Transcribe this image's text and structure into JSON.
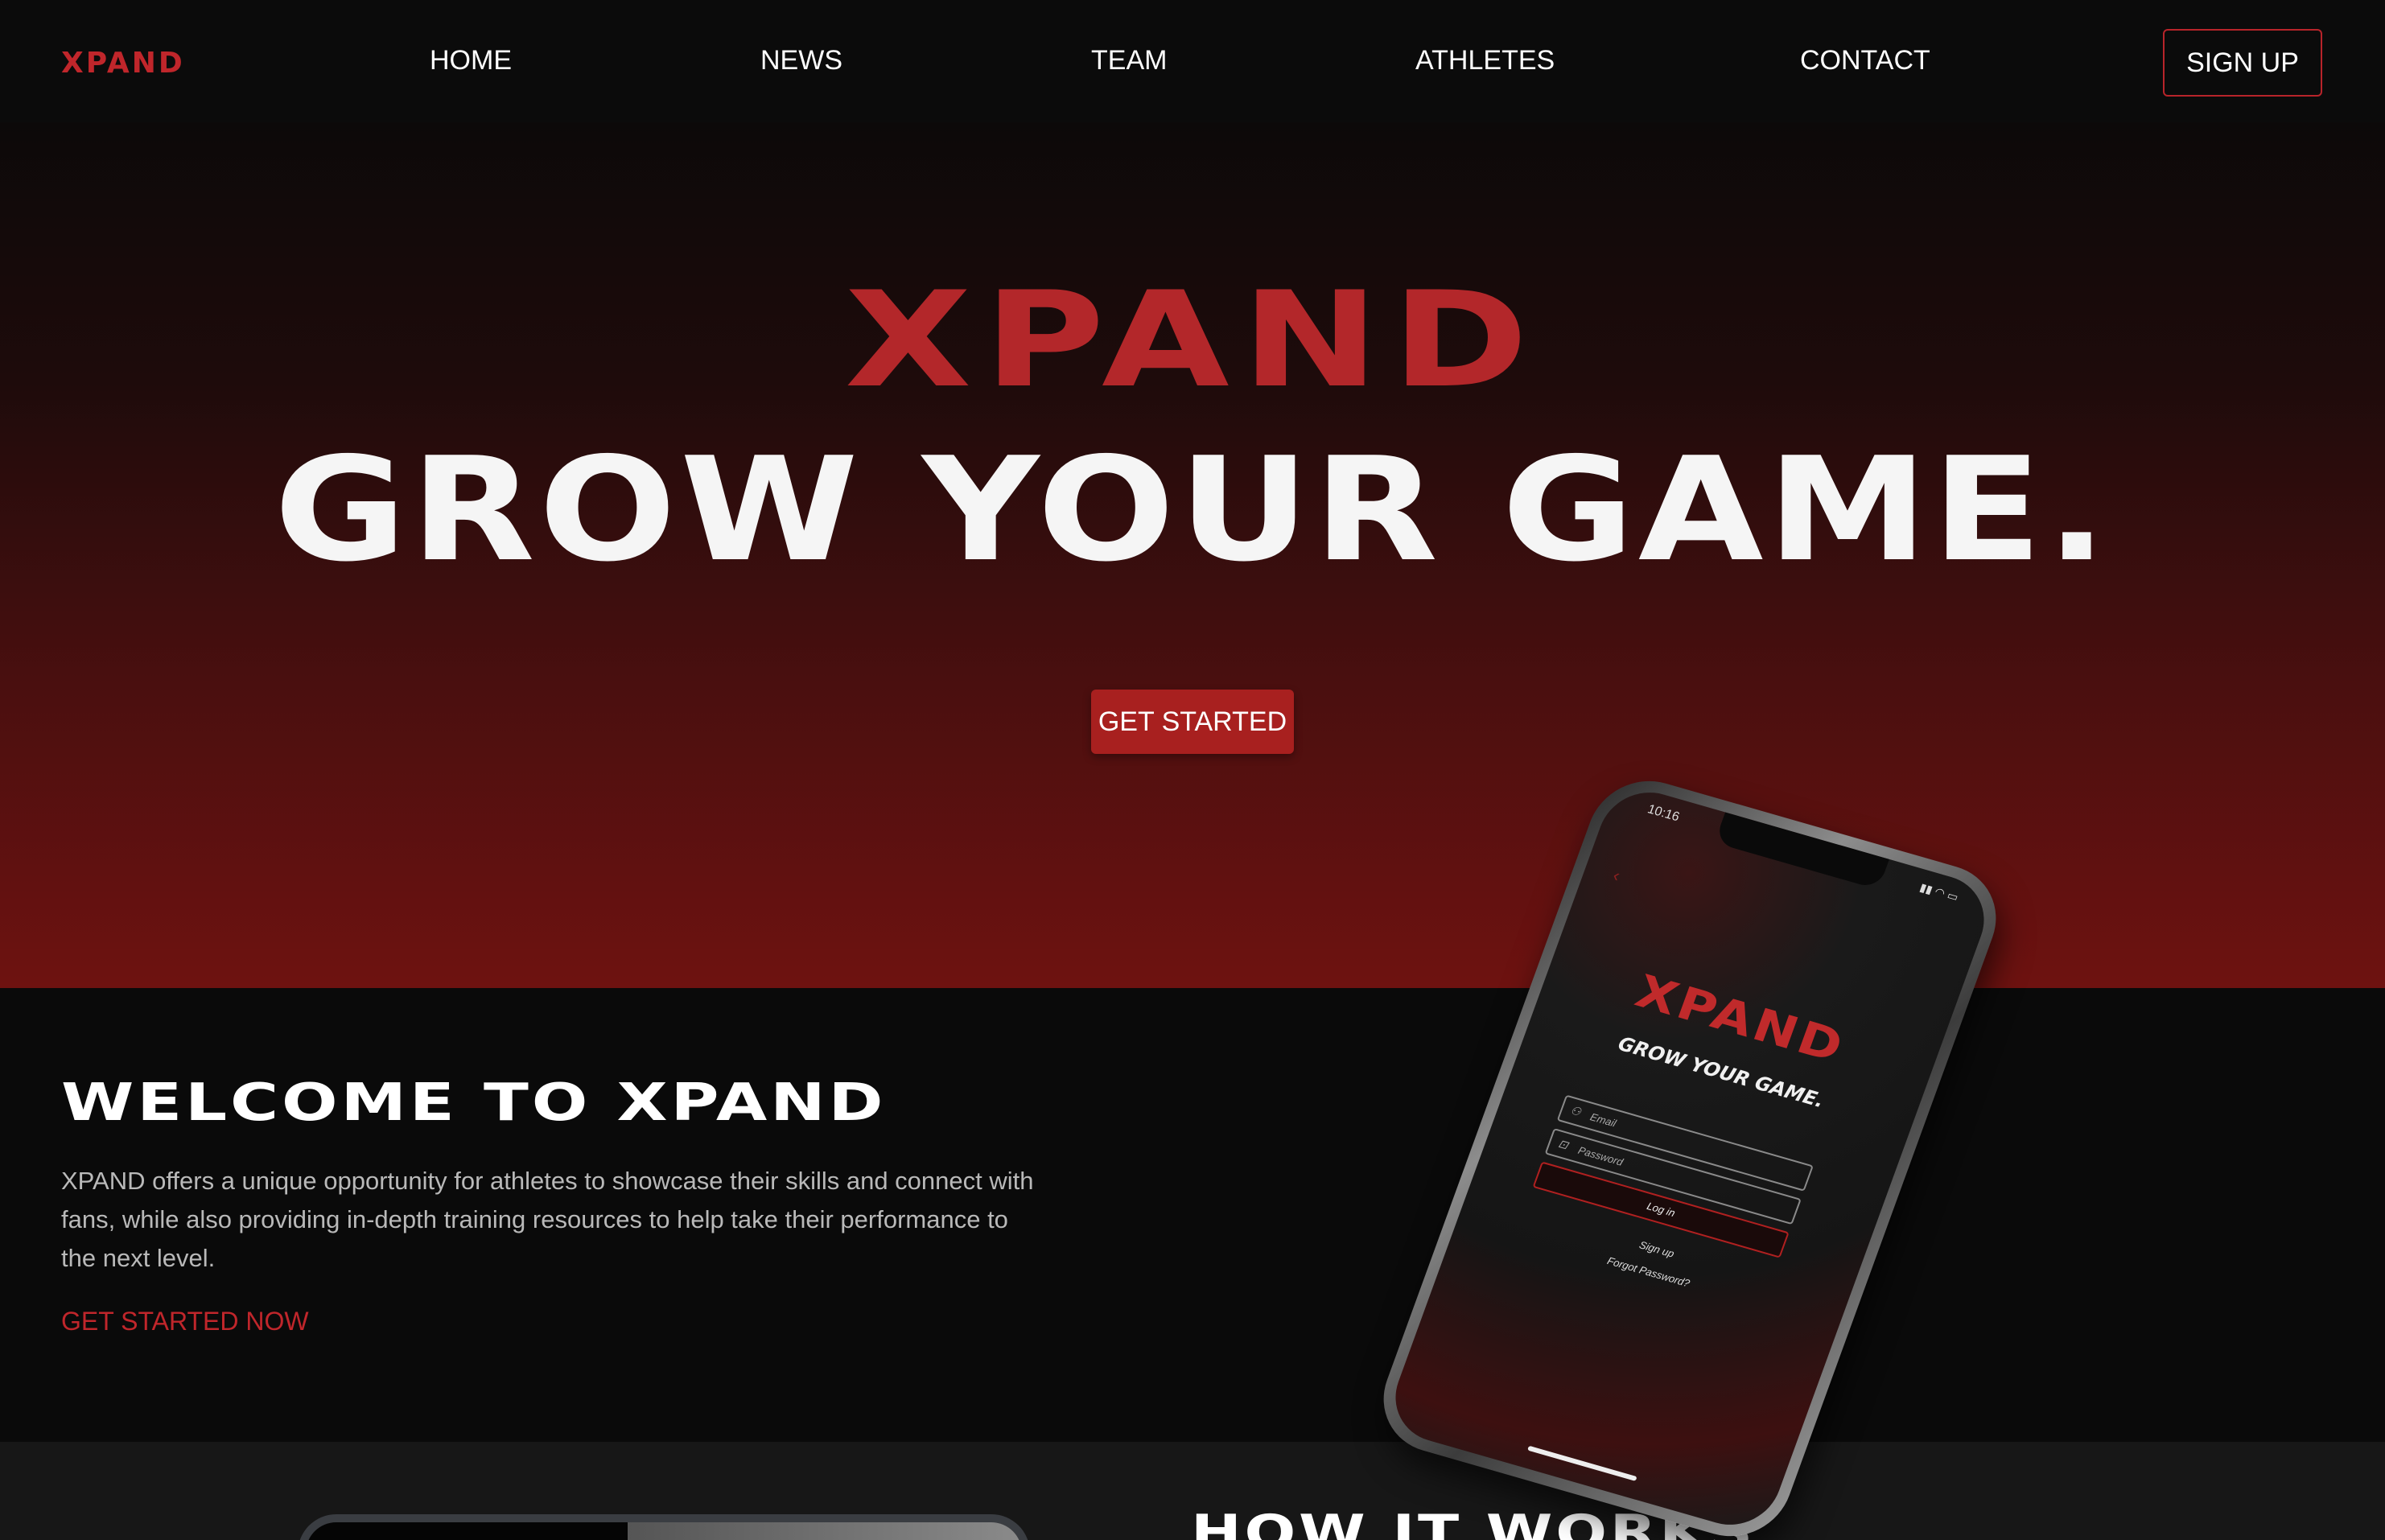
{
  "nav": {
    "logo": "XPAND",
    "links": [
      "HOME",
      "NEWS",
      "TEAM",
      "ATHLETES",
      "CONTACT"
    ],
    "signup_label": "SIGN UP"
  },
  "hero": {
    "logo": "XPAND",
    "title": "GROW YOUR GAME.",
    "cta_label": "GET STARTED"
  },
  "welcome": {
    "title": "WELCOME TO XPAND",
    "text": "XPAND offers a unique opportunity for athletes to showcase their skills and connect with fans, while also providing in-depth training resources to help take their performance to the next level.",
    "link_label": "GET STARTED NOW"
  },
  "how": {
    "title": "HOW IT WORKS"
  },
  "phone_app": {
    "time": "10:16",
    "logo": "XPAND",
    "tagline": "GROW YOUR GAME.",
    "email_placeholder": "Email",
    "password_placeholder": "Password",
    "login_label": "Log in",
    "signup_label": "Sign up",
    "forgot_label": "Forgot Password?"
  },
  "colors": {
    "accent": "#c0262b",
    "background": "#0a0a0a",
    "hero_bottom": "#6e1210"
  }
}
